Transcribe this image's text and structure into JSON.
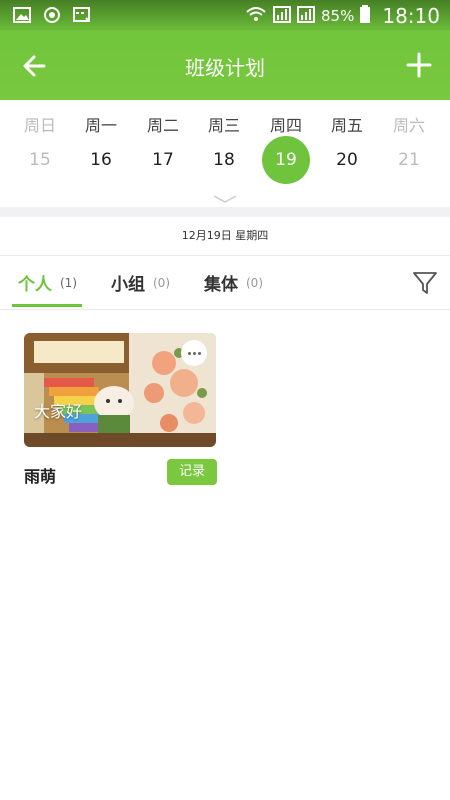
{
  "status": {
    "battery": "85%",
    "time": "18:10"
  },
  "header": {
    "title": "班级计划"
  },
  "week": {
    "days": [
      {
        "weekday": "周日",
        "date": "15"
      },
      {
        "weekday": "周一",
        "date": "16"
      },
      {
        "weekday": "周二",
        "date": "17"
      },
      {
        "weekday": "周三",
        "date": "18"
      },
      {
        "weekday": "周四",
        "date": "19"
      },
      {
        "weekday": "周五",
        "date": "20"
      },
      {
        "weekday": "周六",
        "date": "21"
      }
    ],
    "selected_index": 4
  },
  "date_line": "12月19日 星期四",
  "tabs": [
    {
      "label": "个人",
      "count": "(1)"
    },
    {
      "label": "小组",
      "count": "(0)"
    },
    {
      "label": "集体",
      "count": "(0)"
    }
  ],
  "card": {
    "caption": "大家好",
    "name": "雨萌",
    "record_label": "记录"
  },
  "colors": {
    "accent": "#6cc43a",
    "record_button": "#79c83f"
  },
  "icons": [
    "back-arrow-icon",
    "add-icon",
    "filter-icon",
    "more-icon",
    "chevron-down-icon"
  ]
}
